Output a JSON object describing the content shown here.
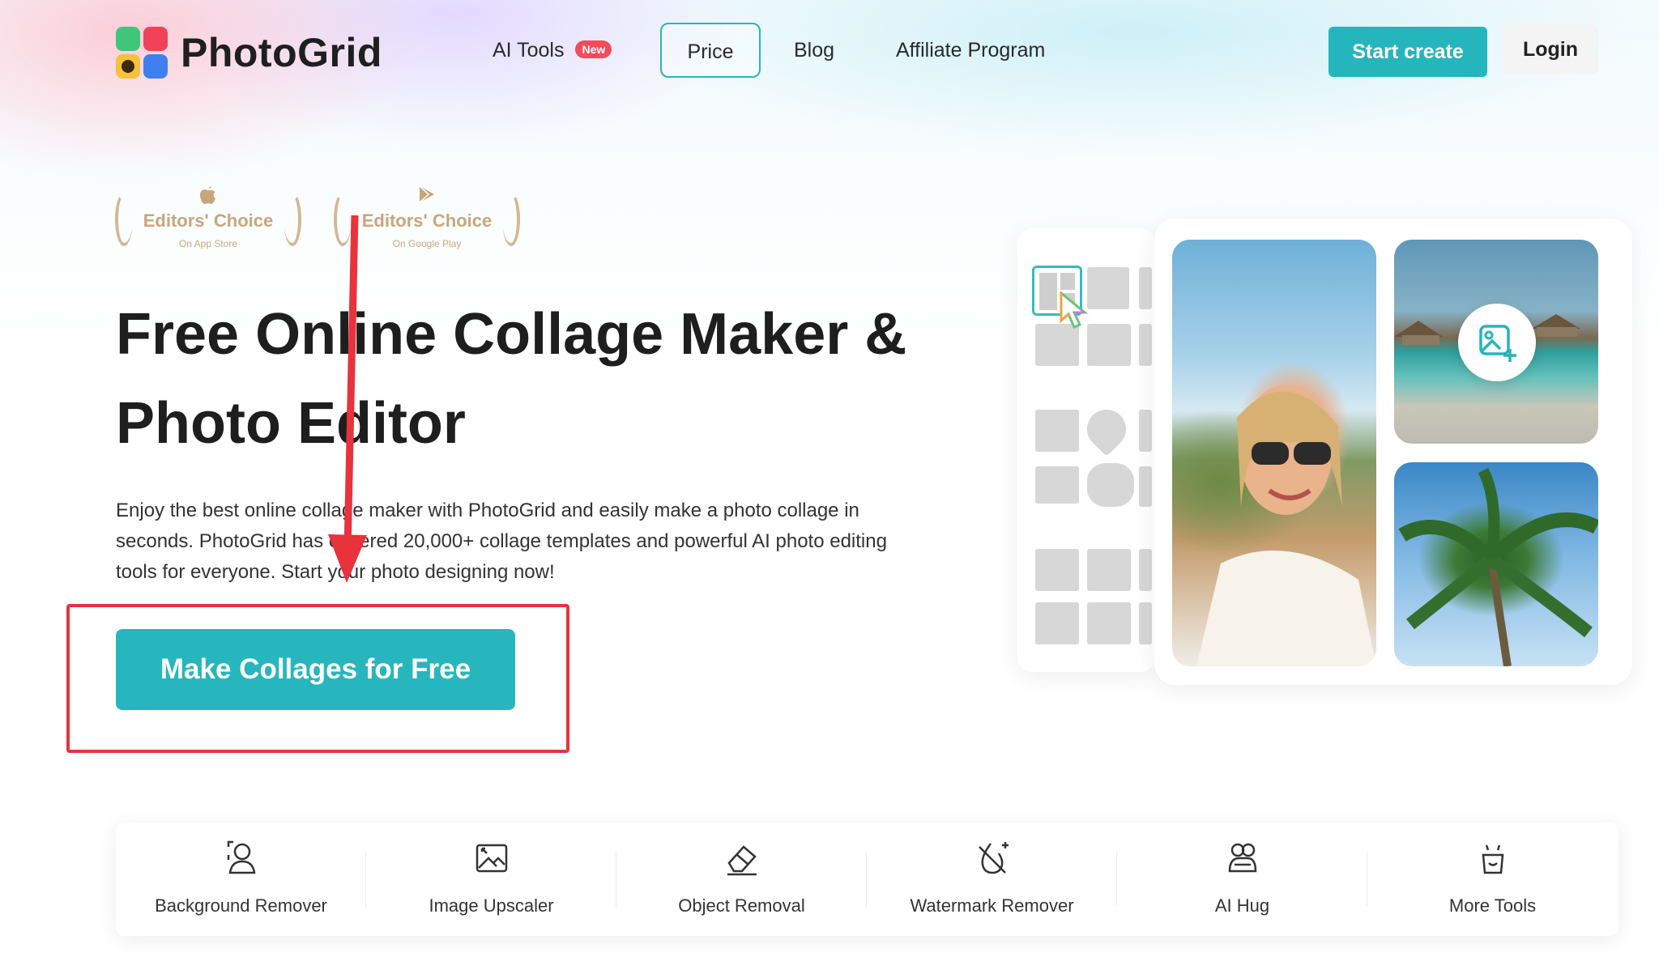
{
  "brand": {
    "name": "PhotoGrid"
  },
  "nav": {
    "ai_tools": "AI Tools",
    "new_badge": "New",
    "price": "Price",
    "blog": "Blog",
    "affiliate": "Affiliate Program",
    "start_create": "Start create",
    "login": "Login"
  },
  "awards": [
    {
      "title": "Editors' Choice",
      "sub": "On App Store",
      "icon": "apple-icon"
    },
    {
      "title": "Editors' Choice",
      "sub": "On Google Play",
      "icon": "google-play-icon"
    }
  ],
  "hero": {
    "title_line1": "Free Online Collage Maker &",
    "title_line2": "Photo Editor",
    "description": "Enjoy the best online collage maker with PhotoGrid and easily make a photo collage in seconds. PhotoGrid has covered 20,000+ collage templates and powerful AI photo editing tools for everyone. Start your photo designing now!",
    "cta": "Make Collages for Free"
  },
  "tools": [
    {
      "label": "Background Remover",
      "icon": "person-cutout-icon"
    },
    {
      "label": "Image Upscaler",
      "icon": "image-upscale-icon"
    },
    {
      "label": "Object Removal",
      "icon": "eraser-icon"
    },
    {
      "label": "Watermark Remover",
      "icon": "watermark-remove-icon"
    },
    {
      "label": "AI Hug",
      "icon": "hug-icon"
    },
    {
      "label": "More Tools",
      "icon": "smile-bag-icon"
    }
  ],
  "colors": {
    "accent": "#27b6be",
    "annotation_red": "#e8323c",
    "badge_red": "#f24b5a",
    "award_gold": "#c8a67e"
  }
}
